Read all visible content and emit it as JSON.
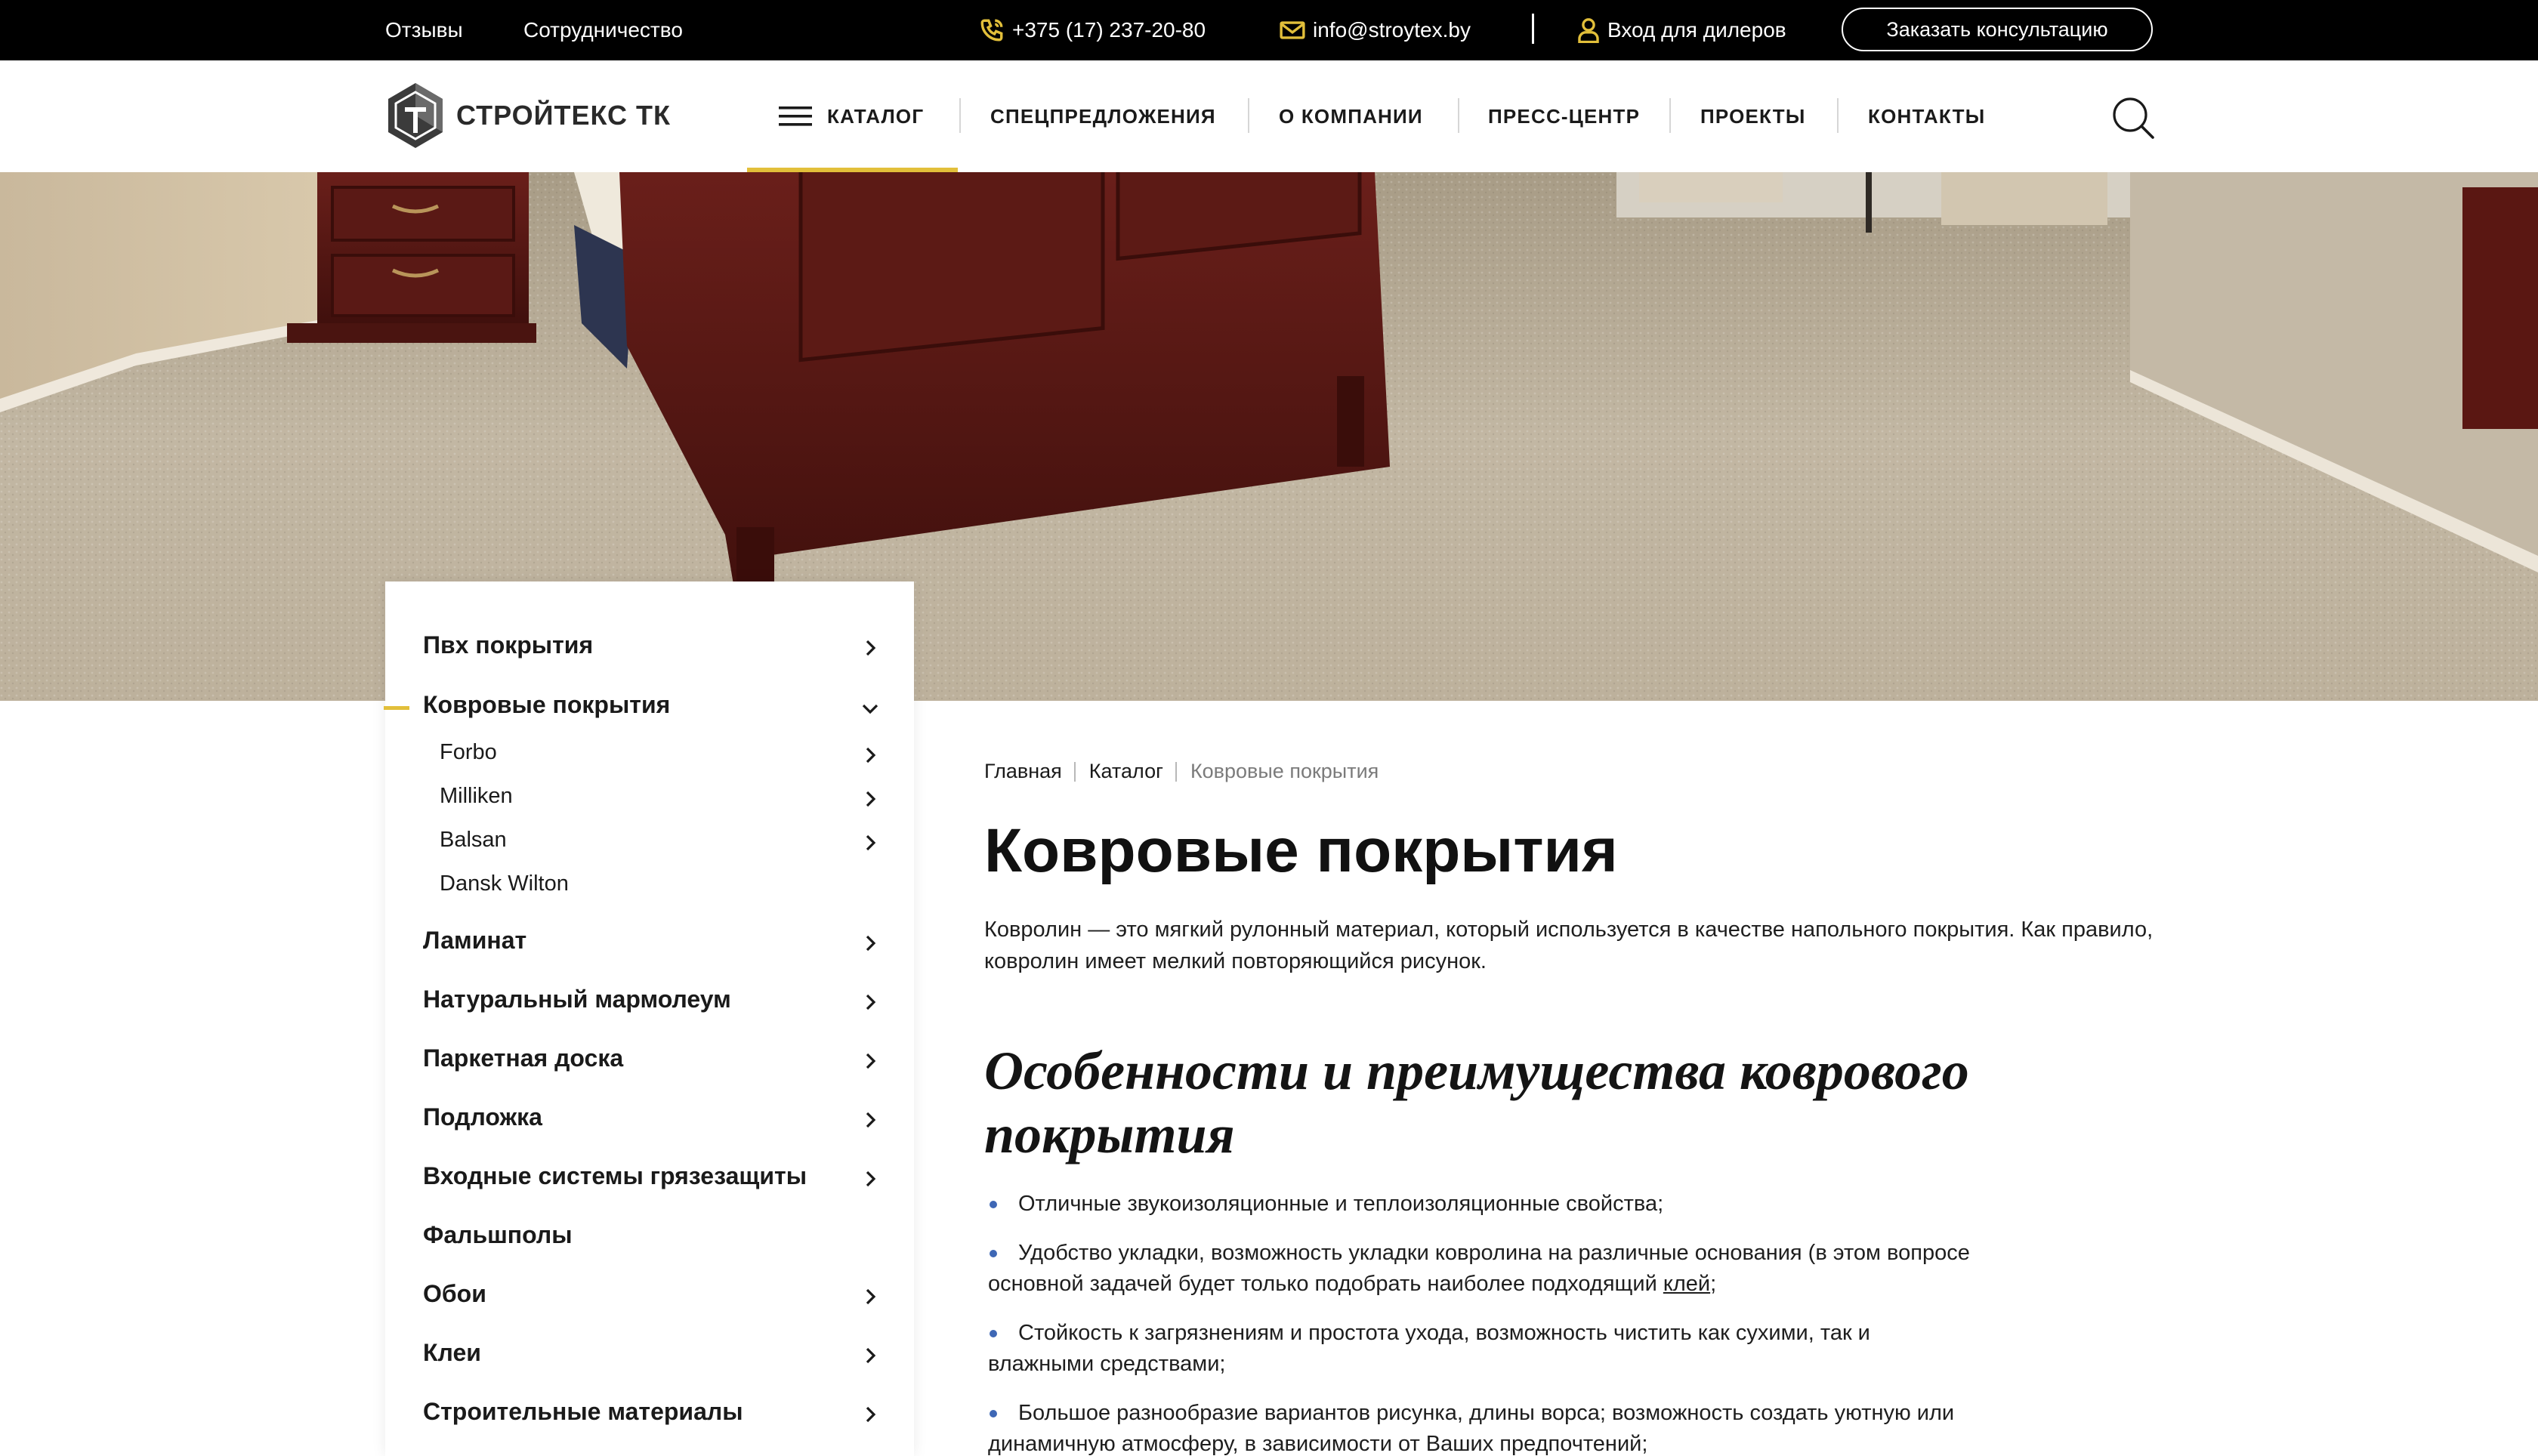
{
  "topbar": {
    "links": [
      "Отзывы",
      "Сотрудничество"
    ],
    "phone": "+375 (17) 237-20-80",
    "email": "info@stroytex.by",
    "dealer_login": "Вход для дилеров",
    "consult_button": "Заказать консультацию"
  },
  "header": {
    "logo_text": "СТРОЙТЕКС ТК",
    "nav": [
      "КАТАЛОГ",
      "СПЕЦПРЕДЛОЖЕНИЯ",
      "О КОМПАНИИ",
      "ПРЕСС-ЦЕНТР",
      "ПРОЕКТЫ",
      "КОНТАКТЫ"
    ],
    "active_nav": "КАТАЛОГ"
  },
  "sidebar": {
    "items": [
      {
        "label": "Пвх покрытия",
        "has_children": true,
        "expanded": false
      },
      {
        "label": "Ковровые покрытия",
        "has_children": true,
        "expanded": true,
        "active": true,
        "children": [
          {
            "label": "Forbo",
            "has_children": true
          },
          {
            "label": "Milliken",
            "has_children": true
          },
          {
            "label": "Balsan",
            "has_children": true
          },
          {
            "label": "Dansk Wilton",
            "has_children": false
          }
        ]
      },
      {
        "label": "Ламинат",
        "has_children": true
      },
      {
        "label": "Натуральный мармолеум",
        "has_children": true
      },
      {
        "label": "Паркетная доска",
        "has_children": true
      },
      {
        "label": "Подложка",
        "has_children": true
      },
      {
        "label": "Входные системы грязезащиты",
        "has_children": true
      },
      {
        "label": "Фальшполы",
        "has_children": false
      },
      {
        "label": "Обои",
        "has_children": true
      },
      {
        "label": "Клеи",
        "has_children": true
      },
      {
        "label": "Строительные материалы",
        "has_children": true
      }
    ]
  },
  "breadcrumb": [
    "Главная",
    "Каталог",
    "Ковровые покрытия"
  ],
  "content": {
    "title": "Ковровые покрытия",
    "intro": "Ковролин — это мягкий рулонный материал, который используется в качестве напольного покрытия. Как правило, ковролин имеет мелкий повторяющийся рисунок.",
    "subheading": "Особенности и преимущества коврового покрытия",
    "bullets": {
      "b1": "Отличные звукоизоляционные и теплоизоляционные свойства;",
      "b2_before": "Удобство укладки, возможность укладки ковролина на различные основания (в этом вопросе основной задачей будет только подобрать наиболее подходящий ",
      "b2_link": "клей",
      "b2_after": ";",
      "b3": "Стойкость к загрязнениям и простота ухода, возможность чистить как сухими, так и влажными средствами;",
      "b4": "Большое разнообразие вариантов рисунка, длины ворса; возможность создать уютную или динамичную атмосферу, в зависимости от Ваших предпочтений;"
    }
  },
  "colors": {
    "accent_yellow": "#e2bf3a",
    "bullet_blue": "#3e67b5",
    "topbar_bg": "#000000"
  },
  "icons": [
    "phone-icon",
    "mail-icon",
    "user-icon",
    "menu-icon",
    "search-icon",
    "chevron-right-icon",
    "chevron-down-icon"
  ]
}
